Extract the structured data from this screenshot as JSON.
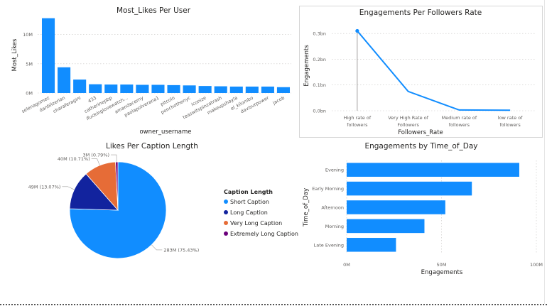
{
  "colors": {
    "primary": "#118DFF",
    "navy": "#12239E",
    "orange": "#E66C37",
    "purple": "#6B007B",
    "grid": "#c8c6c4",
    "text": "#252423",
    "tick": "#605e5c"
  },
  "chart_data": [
    {
      "id": "likes",
      "type": "bar",
      "title": "Most_Likes Per User",
      "xlabel": "owner_username",
      "ylabel": "Most_Likes",
      "ylim": [
        0,
        13000000
      ],
      "yticks": [
        0,
        5000000,
        10000000
      ],
      "ytick_labels": [
        "0M",
        "5M",
        "10M"
      ],
      "grid": true,
      "categories": [
        "selenagomez",
        "danbilzerian",
        "charaferagini",
        "433",
        "catherinepbp",
        "ifuckinglovewatch...",
        "amandacerny",
        "paolapolverana1",
        "pitcolo",
        "ponchothenyc",
        "iconize",
        "teaswitspinzatrash",
        "makeupshayla",
        "el_kilombo",
        "davisurpower",
        "jacob"
      ],
      "values": [
        12800000,
        4400000,
        2300000,
        1500000,
        1450000,
        1450000,
        1400000,
        1400000,
        1350000,
        1300000,
        1200000,
        1150000,
        1100000,
        1100000,
        1100000,
        1000000
      ]
    },
    {
      "id": "engagement",
      "type": "line",
      "title": "Engagements Per Followers Rate",
      "xlabel": "Followers_Rate",
      "ylabel": "Engagements",
      "ylim": [
        0,
        0.35
      ],
      "yticks": [
        0,
        0.1,
        0.2,
        0.3
      ],
      "ytick_labels": [
        "0.0bn",
        "0.1bn",
        "0.2bn",
        "0.3bn"
      ],
      "grid": true,
      "categories": [
        [
          "High rate of",
          "followers"
        ],
        [
          "Very High Rate of",
          "Followers"
        ],
        [
          "Medium rate of",
          "followers"
        ],
        [
          "low rate of",
          "followers"
        ]
      ],
      "values": [
        0.31,
        0.075,
        0.003,
        0.002
      ]
    },
    {
      "id": "caption",
      "type": "pie",
      "title": "Likes Per Caption Length",
      "legend_title": "Caption Length",
      "legend_position": "right",
      "slices": [
        {
          "name": "Short Caption",
          "value": 283,
          "label": "283M (75.43%)",
          "color": "#118DFF"
        },
        {
          "name": "Long Caption",
          "value": 49,
          "label": "49M (13.07%)",
          "color": "#12239E"
        },
        {
          "name": "Very Long Caption",
          "value": 40,
          "label": "40M (10.71%)",
          "color": "#E66C37"
        },
        {
          "name": "Extremely Long Caption",
          "value": 3,
          "label": "3M (0.79%)",
          "color": "#6B007B"
        }
      ]
    },
    {
      "id": "timeofday",
      "type": "bar",
      "orientation": "horizontal",
      "title": "Engagements by Time_of_Day",
      "xlabel": "Engagements",
      "ylabel": "Time_of_Day",
      "xlim": [
        0,
        100000000
      ],
      "xticks": [
        0,
        50000000,
        100000000
      ],
      "xtick_labels": [
        "0M",
        "50M",
        "100M"
      ],
      "grid": true,
      "categories": [
        "Evening",
        "Early Morning",
        "Afternoon",
        "Morning",
        "Late Evening"
      ],
      "values": [
        91000000,
        66000000,
        52000000,
        41000000,
        26000000
      ]
    }
  ]
}
